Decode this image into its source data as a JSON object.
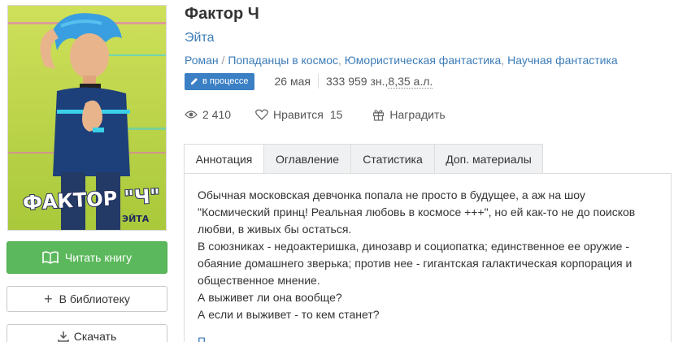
{
  "book": {
    "title": "Фактор Ч",
    "author": "Эйта",
    "genres": [
      "Роман",
      "Попаданцы в космос",
      "Юмористическая фантастика",
      "Научная фантастика"
    ],
    "genre_separators": [
      " / ",
      ", ",
      ", "
    ],
    "status_badge": "в процессе",
    "date": "26 мая",
    "size_chars": "333 959 зн., ",
    "size_al": "8,35 а.л.",
    "cover": {
      "title_text": "ФАКТОР \"Ч\"",
      "author_text": "ЭЙТА",
      "background_color": "#c4d84a"
    }
  },
  "stats": {
    "views": "2 410",
    "likes_label": "Нравится",
    "likes_count": "15",
    "reward_label": "Наградить"
  },
  "actions": {
    "read_label": "Читать книгу",
    "library_label": "В библиотеку",
    "download_label": "Скачать"
  },
  "tabs": [
    {
      "label": "Аннотация",
      "active": true
    },
    {
      "label": "Оглавление",
      "active": false
    },
    {
      "label": "Статистика",
      "active": false
    },
    {
      "label": "Доп. материалы",
      "active": false
    }
  ],
  "annotation": {
    "paragraphs": [
      "Обычная московская девчонка попала не просто в будущее, а аж на шоу \"Космический принц! Реальная любовь в космосе +++\", но ей как-то не до поисков любви, в живых бы остаться.",
      "В союзниках - недоактеришка, динозавр и социопатка; единственное ее оружие - обаяние домашнего зверька; против нее - гигантская галактическая корпорация и общественное мнение.",
      "А выживет ли она вообще?",
      "А если и выживет - то кем станет?"
    ],
    "more_label": "П"
  },
  "colors": {
    "link": "#3d7cb8",
    "read_button": "#5cb85c",
    "badge": "#3b7fc4"
  }
}
